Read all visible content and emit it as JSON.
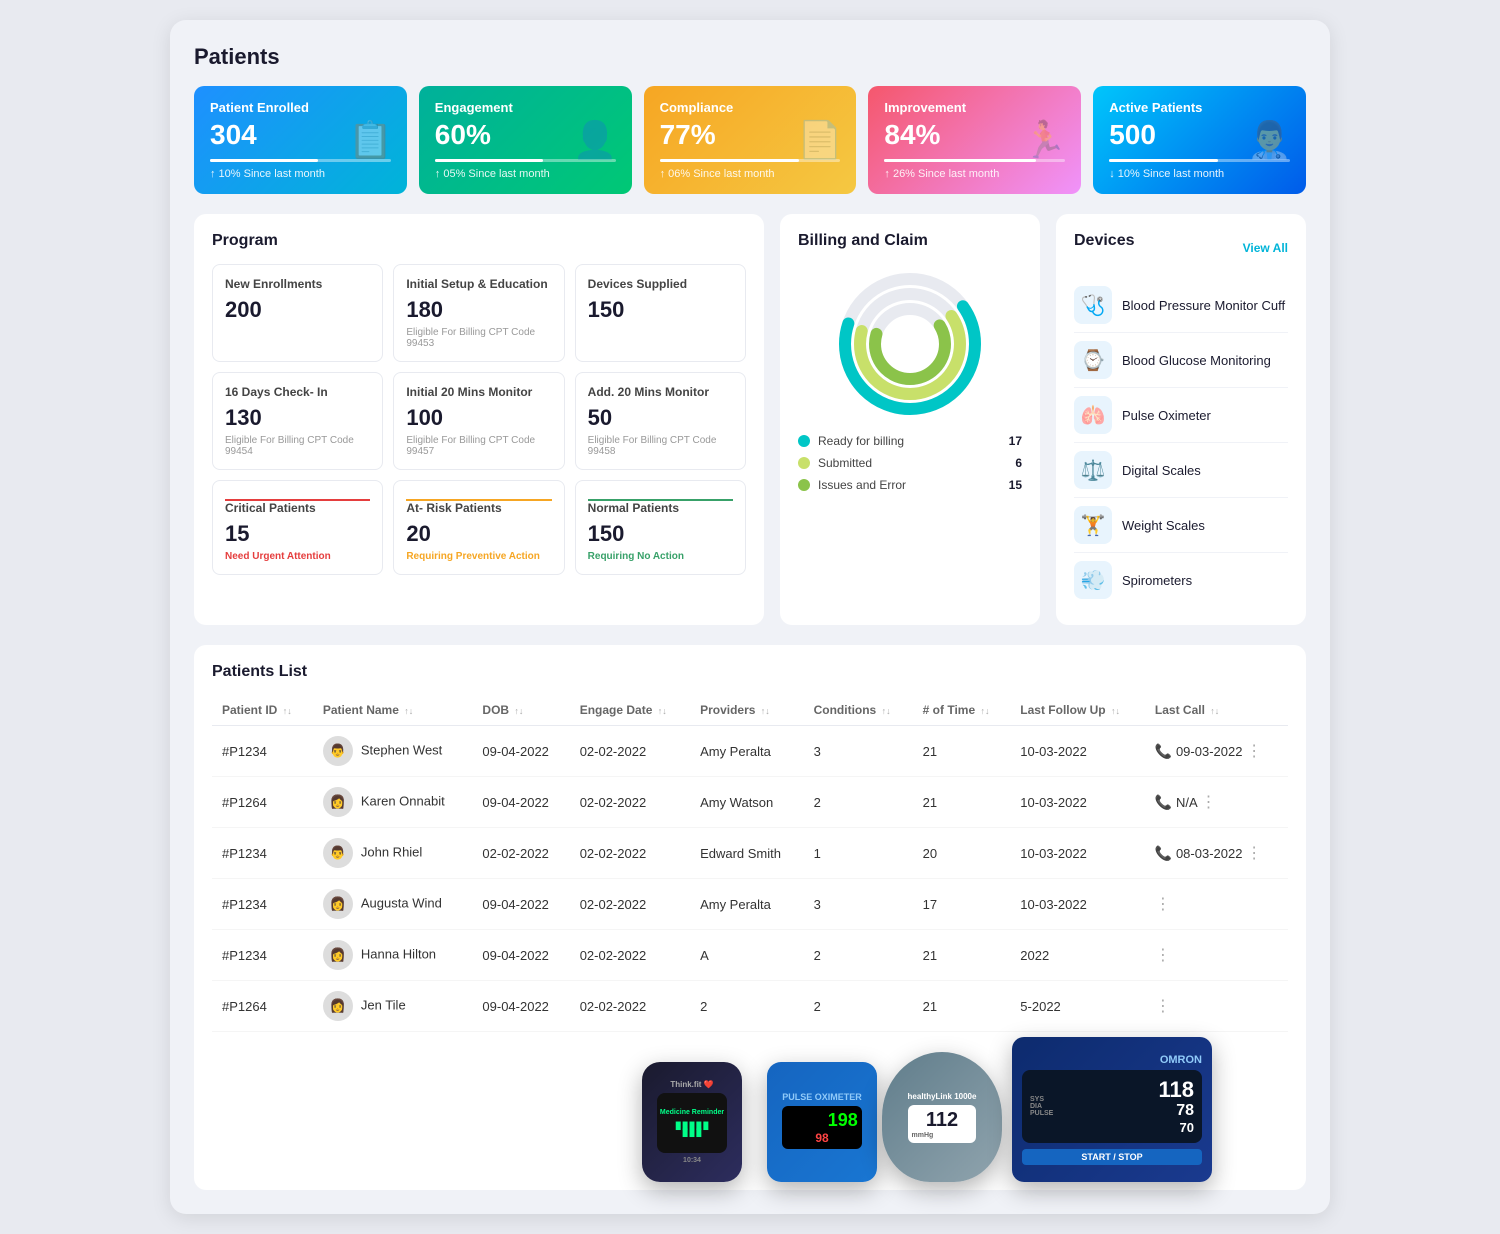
{
  "page": {
    "title": "Patients"
  },
  "stat_cards": [
    {
      "id": "patient-enrolled",
      "title": "Patient Enrolled",
      "value": "304",
      "change": "↑ 10% Since last month",
      "color_class": "card-blue",
      "icon": "📋"
    },
    {
      "id": "engagement",
      "title": "Engagement",
      "value": "60%",
      "change": "↑ 05% Since last month",
      "color_class": "card-green",
      "icon": "👤"
    },
    {
      "id": "compliance",
      "title": "Compliance",
      "value": "77%",
      "change": "↑ 06% Since last month",
      "color_class": "card-yellow",
      "icon": "📄"
    },
    {
      "id": "improvement",
      "title": "Improvement",
      "value": "84%",
      "change": "↑ 26% Since last month",
      "color_class": "card-red",
      "icon": "🏃"
    },
    {
      "id": "active-patients",
      "title": "Active Patients",
      "value": "500",
      "change": "↓ 10% Since last month",
      "color_class": "card-teal",
      "icon": "👨‍⚕️"
    }
  ],
  "program": {
    "title": "Program",
    "cards": [
      {
        "id": "new-enrollments",
        "title": "New Enrollments",
        "value": "200",
        "sub": "",
        "sub_class": ""
      },
      {
        "id": "initial-setup",
        "title": "Initial Setup & Education",
        "value": "180",
        "sub": "Eligible For Billing CPT Code 99453",
        "sub_class": ""
      },
      {
        "id": "devices-supplied",
        "title": "Devices Supplied",
        "value": "150",
        "sub": "",
        "sub_class": ""
      },
      {
        "id": "16-days-checkin",
        "title": "16 Days Check- In",
        "value": "130",
        "sub": "Eligible For Billing CPT Code 99454",
        "sub_class": ""
      },
      {
        "id": "initial-20-mins",
        "title": "Initial 20 Mins Monitor",
        "value": "100",
        "sub": "Eligible For Billing CPT Code 99457",
        "sub_class": ""
      },
      {
        "id": "add-20-mins",
        "title": "Add. 20 Mins Monitor",
        "value": "50",
        "sub": "Eligible For Billing CPT Code 99458",
        "sub_class": ""
      },
      {
        "id": "critical-patients",
        "title": "Critical Patients",
        "value": "15",
        "sub": "Need Urgent Attention",
        "sub_class": "red",
        "divider_class": ""
      },
      {
        "id": "at-risk-patients",
        "title": "At- Risk Patients",
        "value": "20",
        "sub": "Requiring Preventive Action",
        "sub_class": "orange",
        "divider_class": "orange"
      },
      {
        "id": "normal-patients",
        "title": "Normal Patients",
        "value": "150",
        "sub": "Requiring No Action",
        "sub_class": "green",
        "divider_class": "green"
      }
    ]
  },
  "billing": {
    "title": "Billing and Claim",
    "legend": [
      {
        "label": "Ready for billing",
        "value": "17",
        "color": "#00c6c6"
      },
      {
        "label": "Submitted",
        "value": "6",
        "color": "#c8e06a"
      },
      {
        "label": "Issues and Error",
        "value": "15",
        "color": "#8bc34a"
      }
    ]
  },
  "devices": {
    "title": "Devices",
    "view_all": "View All",
    "items": [
      {
        "id": "bp-monitor-cuff",
        "name": "Blood Pressure Monitor Cuff",
        "icon": "🩺"
      },
      {
        "id": "blood-glucose",
        "name": "Blood Glucose Monitoring",
        "icon": "⌚"
      },
      {
        "id": "pulse-oximeter",
        "name": "Pulse Oximeter",
        "icon": "🫁"
      },
      {
        "id": "digital-scales",
        "name": "Digital Scales",
        "icon": "⚖️"
      },
      {
        "id": "weight-scales",
        "name": "Weight Scales",
        "icon": "🏋️"
      },
      {
        "id": "spirometers",
        "name": "Spirometers",
        "icon": "💨"
      }
    ]
  },
  "patients_list": {
    "title": "Patients List",
    "columns": [
      "Patient ID",
      "Patient Name",
      "DOB",
      "Engage Date",
      "Providers",
      "Conditions",
      "# of Time",
      "Last Follow Up",
      "Last Call"
    ],
    "rows": [
      {
        "id": "#P1234",
        "name": "Stephen West",
        "dob": "09-04-2022",
        "engage": "02-02-2022",
        "provider": "Amy Peralta",
        "conditions": "3",
        "time": "21",
        "follow": "10-03-2022",
        "call": "09-03-2022",
        "call_status": "green"
      },
      {
        "id": "#P1264",
        "name": "Karen Onnabit",
        "dob": "09-04-2022",
        "engage": "02-02-2022",
        "provider": "Amy Watson",
        "conditions": "2",
        "time": "21",
        "follow": "10-03-2022",
        "call": "N/A",
        "call_status": "gray"
      },
      {
        "id": "#P1234",
        "name": "John Rhiel",
        "dob": "02-02-2022",
        "engage": "02-02-2022",
        "provider": "Edward Smith",
        "conditions": "1",
        "time": "20",
        "follow": "10-03-2022",
        "call": "08-03-2022",
        "call_status": "green"
      },
      {
        "id": "#P1234",
        "name": "Augusta Wind",
        "dob": "09-04-2022",
        "engage": "02-02-2022",
        "provider": "Amy Peralta",
        "conditions": "3",
        "time": "17",
        "follow": "10-03-2022",
        "call": "",
        "call_status": "none"
      },
      {
        "id": "#P1234",
        "name": "Hanna Hilton",
        "dob": "09-04-2022",
        "engage": "02-02-2022",
        "provider": "A",
        "conditions": "2",
        "time": "21",
        "follow": "2022",
        "call": "",
        "call_status": "none"
      },
      {
        "id": "#P1264",
        "name": "Jen Tile",
        "dob": "09-04-2022",
        "engage": "02-02-2022",
        "provider": "2",
        "conditions": "2",
        "time": "21",
        "follow": "5-2022",
        "call": "",
        "call_status": "none"
      }
    ]
  }
}
